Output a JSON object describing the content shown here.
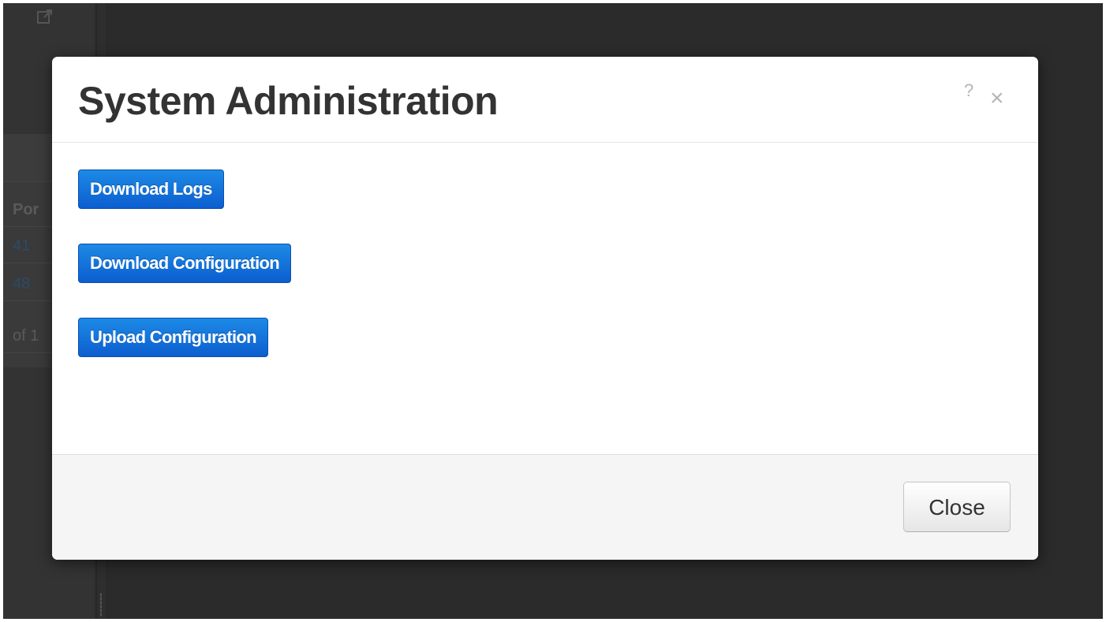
{
  "background": {
    "table_header": "Por",
    "rows": [
      "41",
      "48"
    ],
    "pager_text": "of 1",
    "icons": [
      "external-link-icon"
    ]
  },
  "modal": {
    "title": "System Administration",
    "help_label": "?",
    "close_x_label": "×",
    "actions": [
      {
        "label": "Download Logs"
      },
      {
        "label": "Download Configuration"
      },
      {
        "label": "Upload Configuration"
      }
    ],
    "footer": {
      "close_label": "Close"
    }
  },
  "colors": {
    "primary_button": "#0c6fd8",
    "overlay_background": "#2b2b2b",
    "title_text": "#333333",
    "footer_background": "#f5f5f5"
  }
}
